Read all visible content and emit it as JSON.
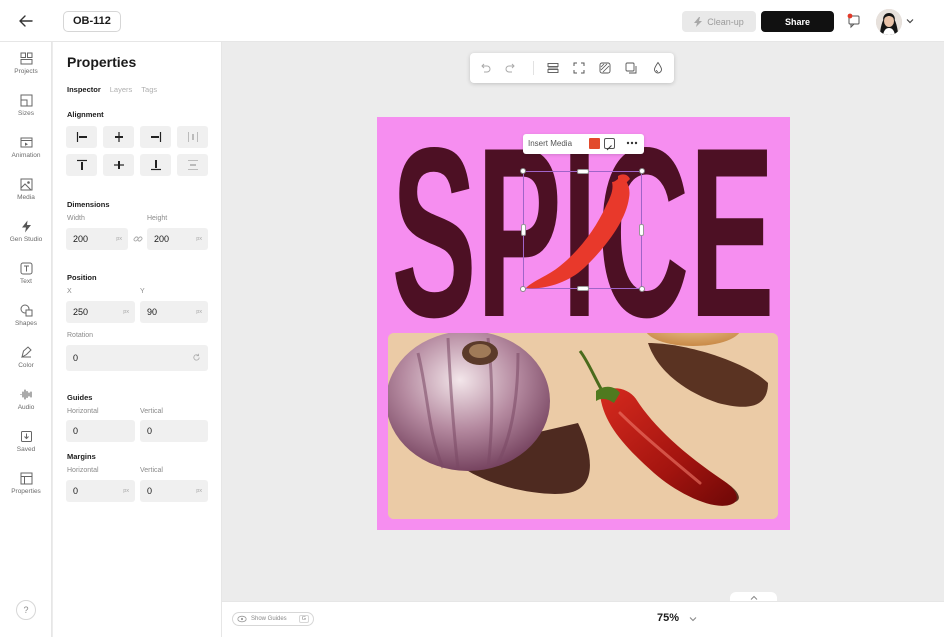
{
  "header": {
    "doc_id": "OB-112",
    "cleanup_label": "Clean-up",
    "share_label": "Share"
  },
  "rail": {
    "items": [
      {
        "label": "Projects",
        "icon": "projects-icon"
      },
      {
        "label": "Sizes",
        "icon": "sizes-icon"
      },
      {
        "label": "Animation",
        "icon": "animation-icon"
      },
      {
        "label": "Media",
        "icon": "media-icon"
      },
      {
        "label": "Gen Studio",
        "icon": "gen-studio-icon"
      },
      {
        "label": "Text",
        "icon": "text-icon"
      },
      {
        "label": "Shapes",
        "icon": "shapes-icon"
      },
      {
        "label": "Color",
        "icon": "color-icon"
      },
      {
        "label": "Audio",
        "icon": "audio-icon"
      },
      {
        "label": "Saved",
        "icon": "saved-icon"
      },
      {
        "label": "Properties",
        "icon": "properties-icon"
      }
    ],
    "help": "?"
  },
  "panel": {
    "title": "Properties",
    "tabs": [
      "Inspector",
      "Layers",
      "Tags"
    ],
    "alignment_title": "Alignment",
    "dimensions": {
      "title": "Dimensions",
      "width_label": "Width",
      "width_value": "200",
      "height_label": "Height",
      "height_value": "200",
      "unit": "px"
    },
    "position": {
      "title": "Position",
      "x_label": "X",
      "x_value": "250",
      "y_label": "Y",
      "y_value": "90",
      "unit": "px",
      "rotation_label": "Rotation",
      "rotation_value": "0"
    },
    "guides": {
      "title": "Guides",
      "horizontal_label": "Horizontal",
      "horizontal_value": "0",
      "vertical_label": "Vertical",
      "vertical_value": "0"
    },
    "margins": {
      "title": "Margins",
      "horizontal_label": "Horizontal",
      "horizontal_value": "0",
      "vertical_label": "Vertical",
      "vertical_value": "0",
      "unit": "px"
    }
  },
  "canvas": {
    "headline": "SPICE",
    "insert_media_label": "Insert Media",
    "swatch_color": "#e24a2b",
    "artboard_color": "#f68ef0",
    "headline_color": "#4d1024"
  },
  "footer": {
    "show_guides_label": "Show Guides",
    "shortcut": "G",
    "zoom": "75%"
  }
}
